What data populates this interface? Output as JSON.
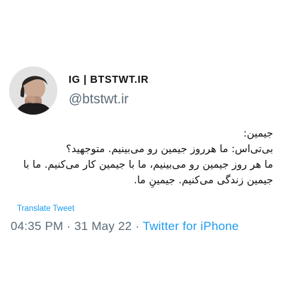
{
  "author": {
    "display_name": "IG | BTSTWT.IR",
    "handle": "@btstwt.ir"
  },
  "tweet": {
    "lines": [
      "جیمین:",
      "بی‌تی‌اس: ما هرروز جیمین رو می‌بینیم. متوجهید؟",
      "ما هر روز جیمین رو می‌بینیم، ما با جیمین کار می‌کنیم. ما با",
      "جیمین زندگی می‌کنیم. جیمینِ ما."
    ],
    "translate_label": "Translate Tweet"
  },
  "meta": {
    "time": "04:35 PM",
    "separator1": " · ",
    "date": "31 May 22",
    "separator2": " · ",
    "source": "Twitter for iPhone"
  },
  "colors": {
    "link": "#1d9bf0",
    "secondary": "#5b6b78"
  }
}
